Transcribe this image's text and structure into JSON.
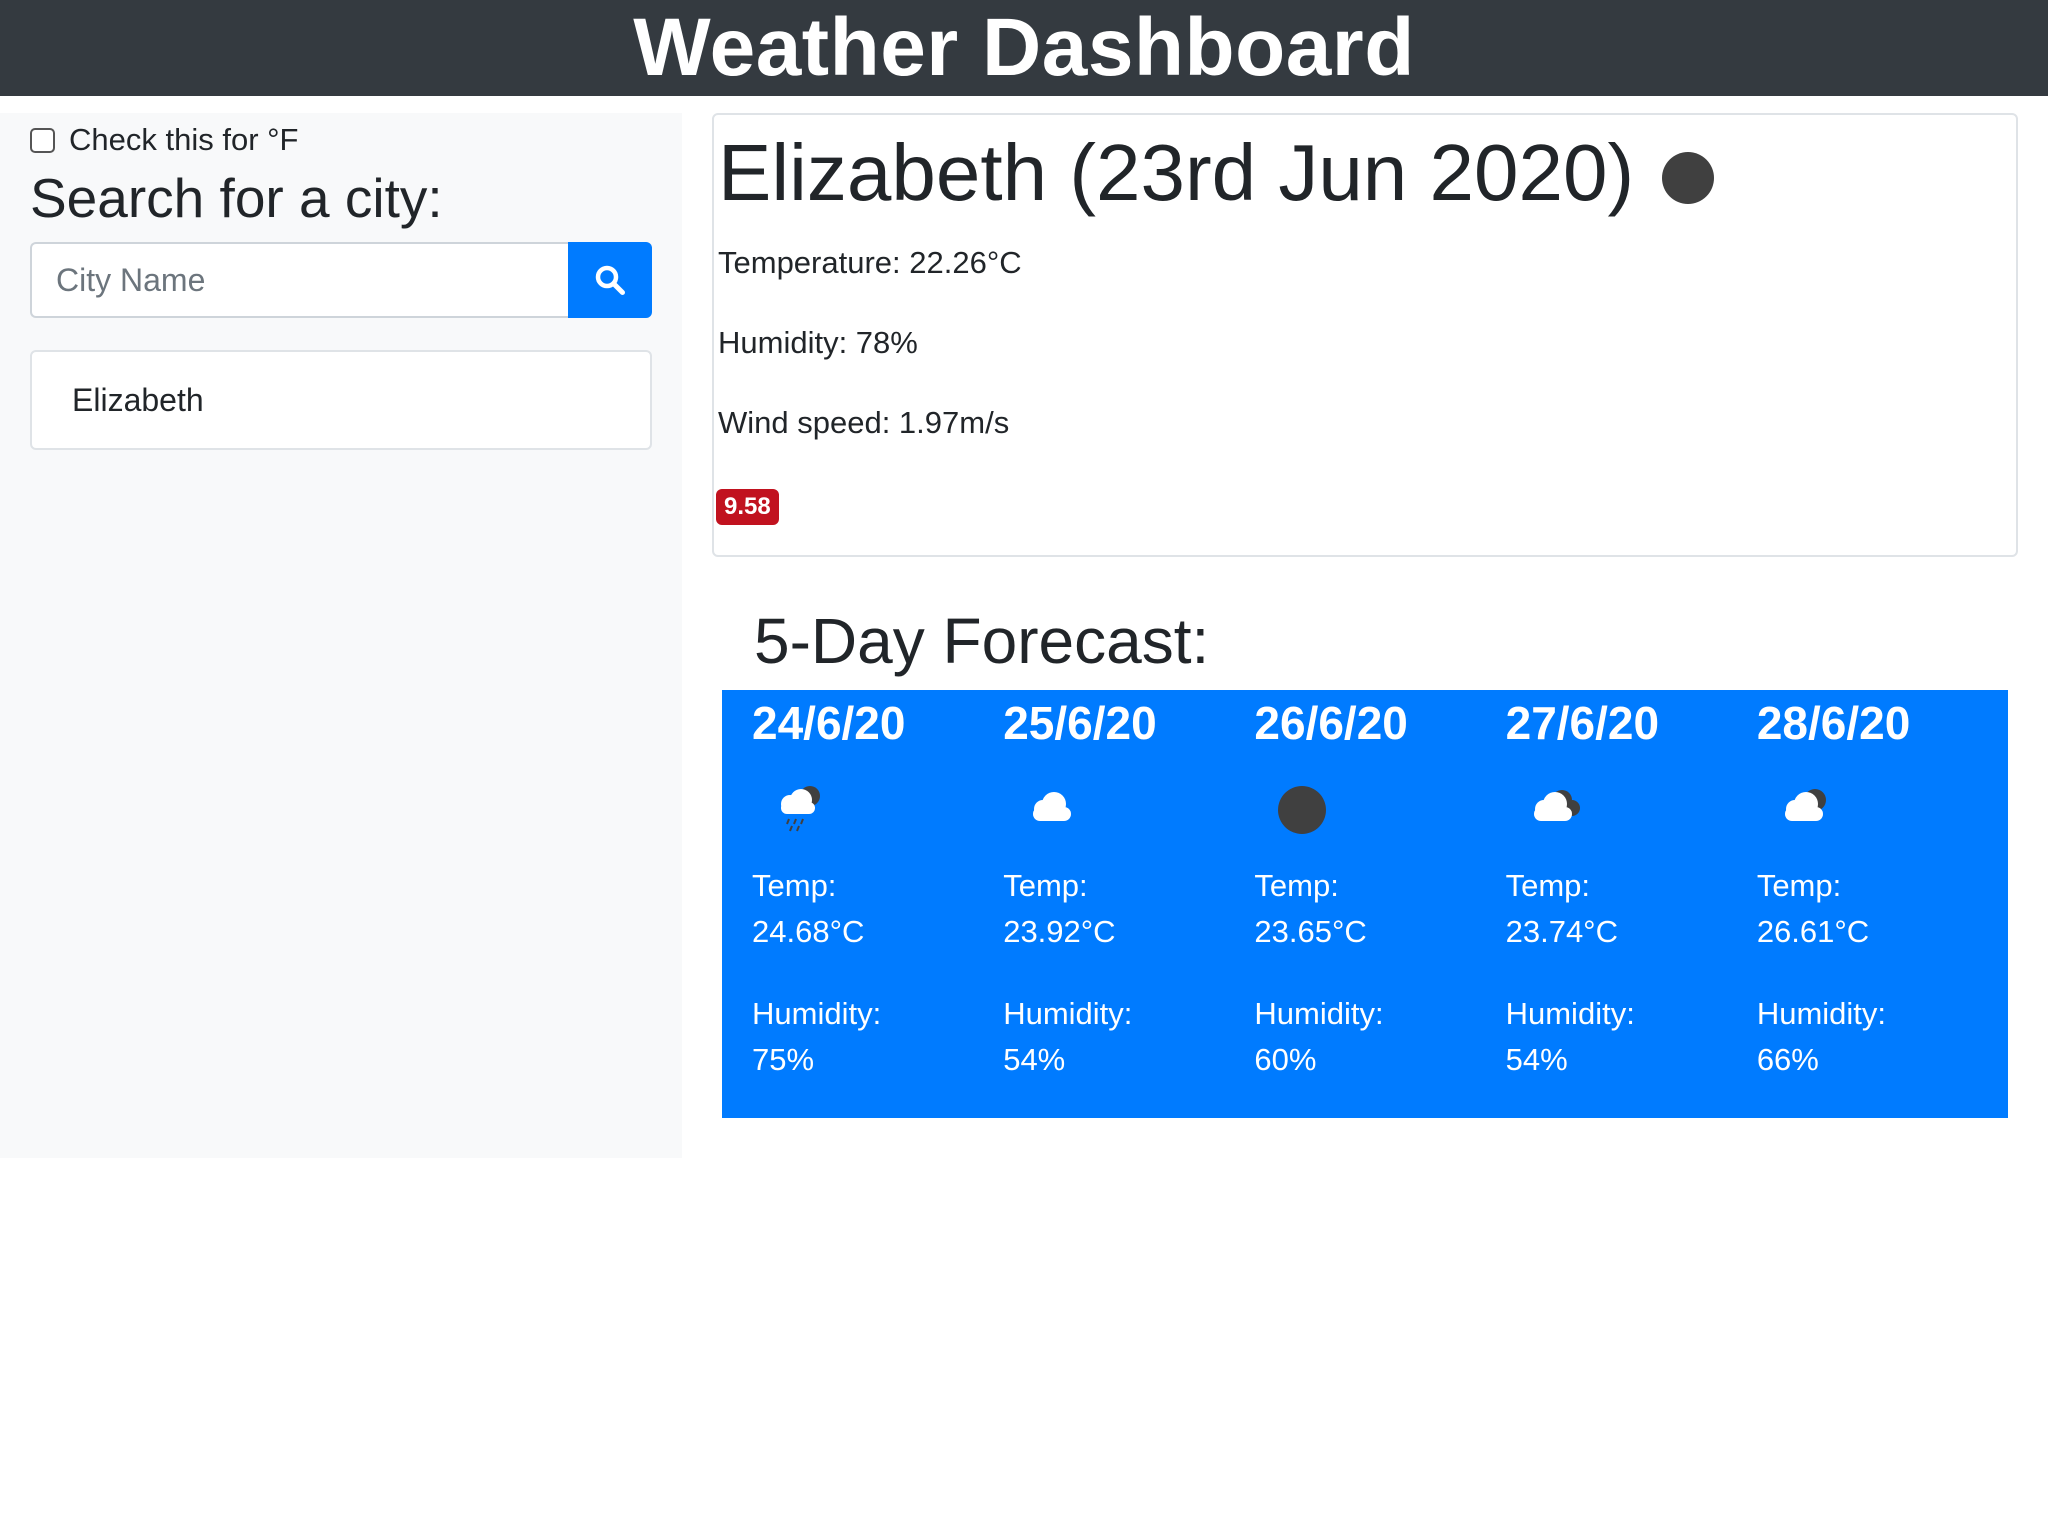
{
  "header": {
    "title": "Weather Dashboard"
  },
  "sidebar": {
    "unit_toggle_label": "Check this for °F",
    "unit_toggle_checked": false,
    "search_heading": "Search for a city:",
    "search_placeholder": "City Name",
    "search_value": "",
    "history": [
      "Elizabeth"
    ]
  },
  "current": {
    "title": "Elizabeth (23rd Jun 2020)",
    "icon": "moon-icon",
    "temperature": "Temperature: 22.26°C",
    "humidity": "Humidity: 78%",
    "wind": "Wind speed: 1.97m/s",
    "uv_index": "9.58",
    "uv_color": "#c1121f"
  },
  "forecast": {
    "heading": "5-Day Forecast:",
    "accent": "#007bff",
    "temp_label": "Temp:",
    "humidity_label": "Humidity:",
    "days": [
      {
        "date": "24/6/20",
        "icon": "rain-cloud-icon",
        "temp": "24.68°C",
        "humidity": "75%"
      },
      {
        "date": "25/6/20",
        "icon": "cloud-icon",
        "temp": "23.92°C",
        "humidity": "54%"
      },
      {
        "date": "26/6/20",
        "icon": "moon-icon",
        "temp": "23.65°C",
        "humidity": "60%"
      },
      {
        "date": "27/6/20",
        "icon": "broken-clouds-icon",
        "temp": "23.74°C",
        "humidity": "54%"
      },
      {
        "date": "28/6/20",
        "icon": "night-cloud-icon",
        "temp": "26.61°C",
        "humidity": "66%"
      }
    ]
  }
}
